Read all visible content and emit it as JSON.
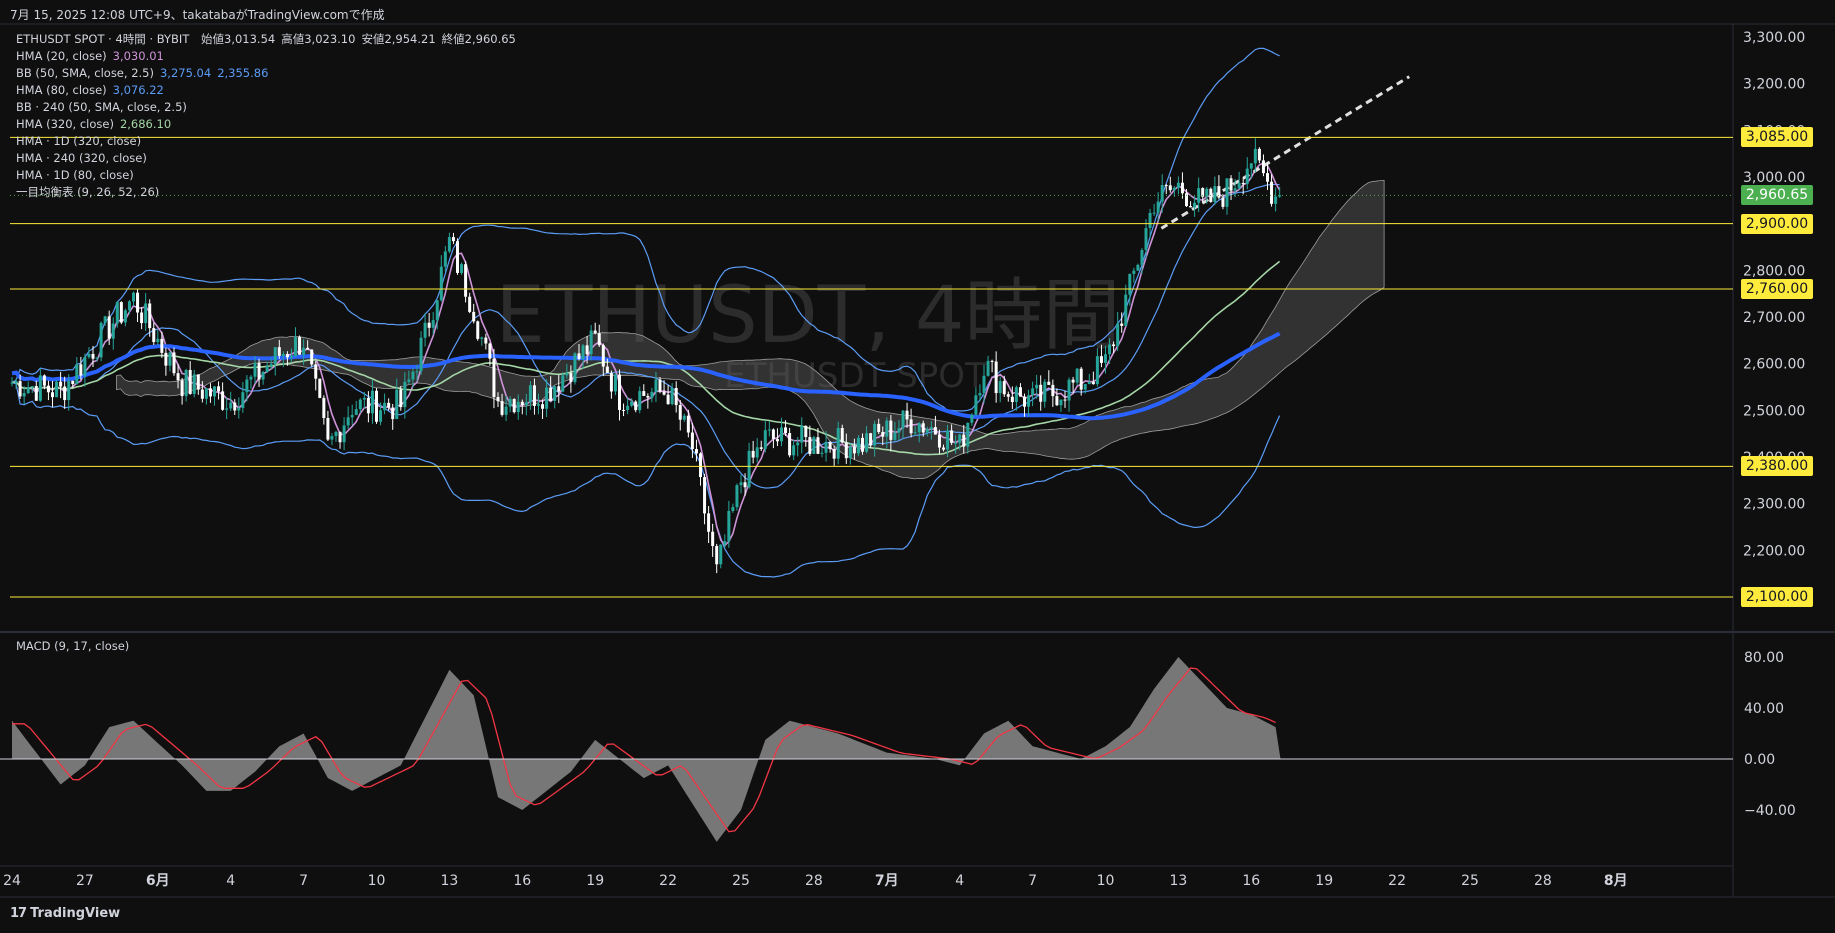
{
  "header": {
    "timestamp_line": "7月 15, 2025 12:08 UTC+9、takatabaがTradingView.comで作成"
  },
  "symbol": {
    "title": "ETHUSDT SPOT · 4時間 · BYBIT",
    "ohlc": [
      {
        "label": "始値",
        "value": "3,013.54"
      },
      {
        "label": "高値",
        "value": "3,023.10"
      },
      {
        "label": "安値",
        "value": "2,954.21"
      },
      {
        "label": "終値",
        "value": "2,960.65"
      }
    ]
  },
  "watermark": {
    "main": "ETHUSDT, 4時間",
    "sub": "ETHUSDT SPOT"
  },
  "indicators": [
    {
      "name": "HMA (20, close)",
      "values": [
        "3,030.01"
      ],
      "colors": [
        "#ce93d8"
      ]
    },
    {
      "name": "BB (50, SMA, close, 2.5)",
      "values": [
        "3,275.04",
        "2,355.86"
      ],
      "colors": [
        "#5b9cf6",
        "#5b9cf6"
      ]
    },
    {
      "name": "HMA (80, close)",
      "values": [
        "3,076.22"
      ],
      "colors": [
        "#5b9cf6"
      ]
    },
    {
      "name": "BB · 240 (50, SMA, close, 2.5)",
      "values": [],
      "colors": []
    },
    {
      "name": "HMA (320, close)",
      "values": [
        "2,686.10"
      ],
      "colors": [
        "#a5d6a7"
      ]
    },
    {
      "name": "HMA · 1D (320, close)",
      "values": [],
      "colors": []
    },
    {
      "name": "HMA · 240 (320, close)",
      "values": [],
      "colors": []
    },
    {
      "name": "HMA · 1D (80, close)",
      "values": [],
      "colors": []
    },
    {
      "name": "一目均衡表 (9, 26, 52, 26)",
      "values": [],
      "colors": []
    }
  ],
  "macd": {
    "label": "MACD (9, 17, close)",
    "ticks": [
      "80.00",
      "40.00",
      "0.00",
      "−40.00"
    ]
  },
  "price_axis": {
    "ticks": [
      "3,300.00",
      "3,200.00",
      "3,100.00",
      "3,000.00",
      "2,900.00",
      "2,800.00",
      "2,700.00",
      "2,600.00",
      "2,500.00",
      "2,400.00",
      "2,300.00",
      "2,200.00",
      "2,100.00"
    ],
    "current_price": "2,960.65",
    "level_tags": [
      "3,085.00",
      "2,900.00",
      "2,760.00",
      "2,380.00",
      "2,100.00"
    ]
  },
  "time_axis": {
    "labels": [
      "24",
      "27",
      "6月",
      "4",
      "7",
      "10",
      "13",
      "16",
      "19",
      "22",
      "25",
      "28",
      "7月",
      "4",
      "7",
      "10",
      "13",
      "16",
      "19",
      "22",
      "25",
      "28",
      "8月"
    ],
    "bold": [
      "6月",
      "7月",
      "8月"
    ]
  },
  "branding": {
    "logo_text": "TradingView"
  },
  "colors": {
    "background": "#0f0f0f",
    "up_candle": "#26a69a",
    "down_candle": "#ffffff",
    "level_line": "#ffeb3b",
    "level_tag_bg": "#ffeb3b",
    "current_tag_bg": "#4caf50",
    "bb": "#5b9cf6",
    "hma20": "#ce93d8",
    "hma80": "#2962ff",
    "hma320": "#a5d6a7",
    "cloud": "#5d5d5d",
    "macd_hist": "#8a8a8a",
    "macd_signal": "#f23645"
  },
  "chart_data": {
    "type": "candlestick",
    "title": "ETHUSDT SPOT · 4時間 · BYBIT",
    "x_range": [
      "2025-05-24",
      "2025-08-01"
    ],
    "ylim": [
      2080,
      3330
    ],
    "y_ticks": [
      2100,
      2200,
      2300,
      2400,
      2500,
      2600,
      2700,
      2800,
      2900,
      3000,
      3100,
      3200,
      3300
    ],
    "horizontal_levels": [
      3085,
      2900,
      2760,
      2380,
      2100
    ],
    "current_price": 2960.65,
    "price_path": [
      {
        "date": "05-24",
        "price": 2560
      },
      {
        "date": "05-26",
        "price": 2540
      },
      {
        "date": "05-28",
        "price": 2680
      },
      {
        "date": "05-29",
        "price": 2740
      },
      {
        "date": "05-31",
        "price": 2560
      },
      {
        "date": "06-02",
        "price": 2520
      },
      {
        "date": "06-04",
        "price": 2620
      },
      {
        "date": "06-05",
        "price": 2650
      },
      {
        "date": "06-06",
        "price": 2420
      },
      {
        "date": "06-07",
        "price": 2510
      },
      {
        "date": "06-09",
        "price": 2510
      },
      {
        "date": "06-10",
        "price": 2660
      },
      {
        "date": "06-11",
        "price": 2860
      },
      {
        "date": "06-12",
        "price": 2720
      },
      {
        "date": "06-13",
        "price": 2520
      },
      {
        "date": "06-15",
        "price": 2540
      },
      {
        "date": "06-17",
        "price": 2650
      },
      {
        "date": "06-18",
        "price": 2530
      },
      {
        "date": "06-20",
        "price": 2540
      },
      {
        "date": "06-21",
        "price": 2420
      },
      {
        "date": "06-22",
        "price": 2150
      },
      {
        "date": "06-23",
        "price": 2350
      },
      {
        "date": "06-24",
        "price": 2440
      },
      {
        "date": "06-26",
        "price": 2430
      },
      {
        "date": "06-28",
        "price": 2430
      },
      {
        "date": "06-30",
        "price": 2480
      },
      {
        "date": "07-01",
        "price": 2460
      },
      {
        "date": "07-02",
        "price": 2420
      },
      {
        "date": "07-03",
        "price": 2600
      },
      {
        "date": "07-04",
        "price": 2540
      },
      {
        "date": "07-05",
        "price": 2520
      },
      {
        "date": "07-07",
        "price": 2560
      },
      {
        "date": "07-08",
        "price": 2600
      },
      {
        "date": "07-09",
        "price": 2760
      },
      {
        "date": "07-10",
        "price": 2950
      },
      {
        "date": "07-11",
        "price": 2980
      },
      {
        "date": "07-12",
        "price": 2940
      },
      {
        "date": "07-13",
        "price": 2970
      },
      {
        "date": "07-14",
        "price": 3040
      },
      {
        "date": "07-15",
        "price": 2960.65
      }
    ],
    "macd_ylim": [
      -70,
      95
    ],
    "macd_ticks": [
      80,
      40,
      0,
      -40
    ],
    "macd_hist_path": [
      {
        "date": "05-24",
        "value": 30
      },
      {
        "date": "05-26",
        "value": -20
      },
      {
        "date": "05-27",
        "value": -5
      },
      {
        "date": "05-28",
        "value": 25
      },
      {
        "date": "05-29",
        "value": 30
      },
      {
        "date": "05-31",
        "value": -5
      },
      {
        "date": "06-01",
        "value": -25
      },
      {
        "date": "06-02",
        "value": -25
      },
      {
        "date": "06-03",
        "value": -10
      },
      {
        "date": "06-04",
        "value": 10
      },
      {
        "date": "06-05",
        "value": 20
      },
      {
        "date": "06-06",
        "value": -15
      },
      {
        "date": "06-07",
        "value": -25
      },
      {
        "date": "06-09",
        "value": -5
      },
      {
        "date": "06-11",
        "value": 70
      },
      {
        "date": "06-12",
        "value": 50
      },
      {
        "date": "06-13",
        "value": -30
      },
      {
        "date": "06-14",
        "value": -40
      },
      {
        "date": "06-16",
        "value": -10
      },
      {
        "date": "06-17",
        "value": 15
      },
      {
        "date": "06-19",
        "value": -15
      },
      {
        "date": "06-20",
        "value": -5
      },
      {
        "date": "06-21",
        "value": -35
      },
      {
        "date": "06-22",
        "value": -65
      },
      {
        "date": "06-23",
        "value": -40
      },
      {
        "date": "06-24",
        "value": 15
      },
      {
        "date": "06-25",
        "value": 30
      },
      {
        "date": "06-27",
        "value": 20
      },
      {
        "date": "06-29",
        "value": 5
      },
      {
        "date": "07-01",
        "value": 0
      },
      {
        "date": "07-02",
        "value": -5
      },
      {
        "date": "07-03",
        "value": 20
      },
      {
        "date": "07-04",
        "value": 30
      },
      {
        "date": "07-05",
        "value": 10
      },
      {
        "date": "07-07",
        "value": 0
      },
      {
        "date": "07-08",
        "value": 10
      },
      {
        "date": "07-09",
        "value": 25
      },
      {
        "date": "07-10",
        "value": 55
      },
      {
        "date": "07-11",
        "value": 80
      },
      {
        "date": "07-12",
        "value": 60
      },
      {
        "date": "07-13",
        "value": 40
      },
      {
        "date": "07-14",
        "value": 35
      },
      {
        "date": "07-15",
        "value": 25
      }
    ]
  }
}
